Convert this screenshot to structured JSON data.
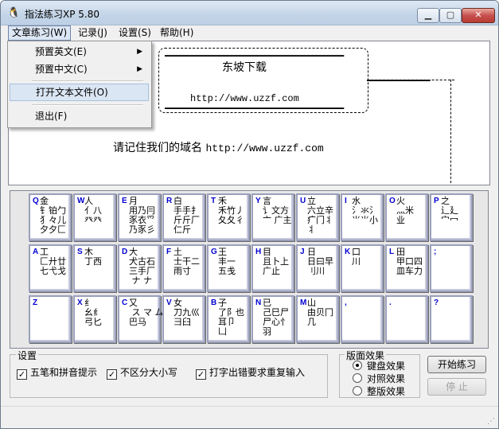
{
  "window": {
    "title": "指法练习XP 5.80",
    "icon": "app-icon"
  },
  "menubar": {
    "items": [
      {
        "label": "文章练习(W)"
      },
      {
        "label": "记录(J)"
      },
      {
        "label": "设置(S)"
      },
      {
        "label": "帮助(H)"
      }
    ]
  },
  "dropdown": {
    "items": [
      {
        "label": "预置英文(E)",
        "submenu": true
      },
      {
        "label": "预置中文(C)",
        "submenu": true
      },
      {
        "label": "打开文本文件(O)",
        "submenu": false
      },
      {
        "label": "退出(F)",
        "submenu": false
      }
    ]
  },
  "text_area": {
    "site_name": "东坡下载",
    "site_url": "http://www.uzzf.com",
    "prompt_cn": "请记住我们的域名",
    "prompt_url": "http://www.uzzf.com"
  },
  "keyboard": {
    "rows": [
      [
        {
          "letter": "Q",
          "roots": "金\n钅铂勹\n犭々儿\n夕夕匚"
        },
        {
          "letter": "W",
          "roots": "人\n亻八\n癶癶"
        },
        {
          "letter": "E",
          "roots": "月\n用乃冃\n豕衣爫\n乃豕彡"
        },
        {
          "letter": "R",
          "roots": "白\n手手扌\n斤斤厂\n仁斤"
        },
        {
          "letter": "T",
          "roots": "禾\n禾竹丿\n夂夂彳"
        },
        {
          "letter": "Y",
          "roots": "言\n讠文方\n亠 广主"
        },
        {
          "letter": "U",
          "roots": "立\n六立辛\n疒门丬\n丬"
        },
        {
          "letter": "I",
          "roots": "水\n氵氺氵\n⺌⺌小"
        },
        {
          "letter": "O",
          "roots": "火\n灬米\n业"
        },
        {
          "letter": "P",
          "roots": "之\n辶廴\n宀冖"
        }
      ],
      [
        {
          "letter": "A",
          "roots": "工\n匚廾廿\n七弋戈"
        },
        {
          "letter": "S",
          "roots": "木\n丁西"
        },
        {
          "letter": "D",
          "roots": "大\n犬古石\n三手厂\n ナ ナ"
        },
        {
          "letter": "F",
          "roots": "土\n士干二\n雨寸"
        },
        {
          "letter": "G",
          "roots": "王\n丰一\n五戋"
        },
        {
          "letter": "H",
          "roots": "目\n且卜上\n广止"
        },
        {
          "letter": "J",
          "roots": "日\n日曰早\n刂川"
        },
        {
          "letter": "K",
          "roots": "口\n川"
        },
        {
          "letter": "L",
          "roots": "田\n甲口四\n皿车力"
        },
        {
          "letter": ";",
          "roots": ""
        }
      ],
      [
        {
          "letter": "Z",
          "roots": ""
        },
        {
          "letter": "X",
          "roots": "纟\n幺纟\n弓匕"
        },
        {
          "letter": "C",
          "roots": "又\n ス マ ム\n巴马"
        },
        {
          "letter": "V",
          "roots": "女\n刀九巛\n彐臼"
        },
        {
          "letter": "B",
          "roots": "子\n了阝也\n耳卩\n凵"
        },
        {
          "letter": "N",
          "roots": "已\n己巳尸\n尸心忄\n羽"
        },
        {
          "letter": "M",
          "roots": "山\n由贝冂\n几"
        },
        {
          "letter": ",",
          "roots": ""
        },
        {
          "letter": ".",
          "roots": ""
        },
        {
          "letter": "?",
          "roots": ""
        }
      ]
    ]
  },
  "settings": {
    "group_label": "设置",
    "checkboxes": [
      {
        "label": "五笔和拼音提示",
        "checked": true
      },
      {
        "label": "不区分大小写",
        "checked": true
      },
      {
        "label": "打字出错要求重复输入",
        "checked": true
      }
    ]
  },
  "layout_effect": {
    "group_label": "版面效果",
    "options": [
      {
        "label": "键盘效果",
        "selected": true
      },
      {
        "label": "对照效果",
        "selected": false
      },
      {
        "label": "整版效果",
        "selected": false
      }
    ]
  },
  "buttons": {
    "start": "开始练习",
    "stop": "停 止"
  },
  "colors": {
    "key_letter": "#0000d0",
    "key_border": "#9aa0bb",
    "close_button": "#c75050"
  }
}
